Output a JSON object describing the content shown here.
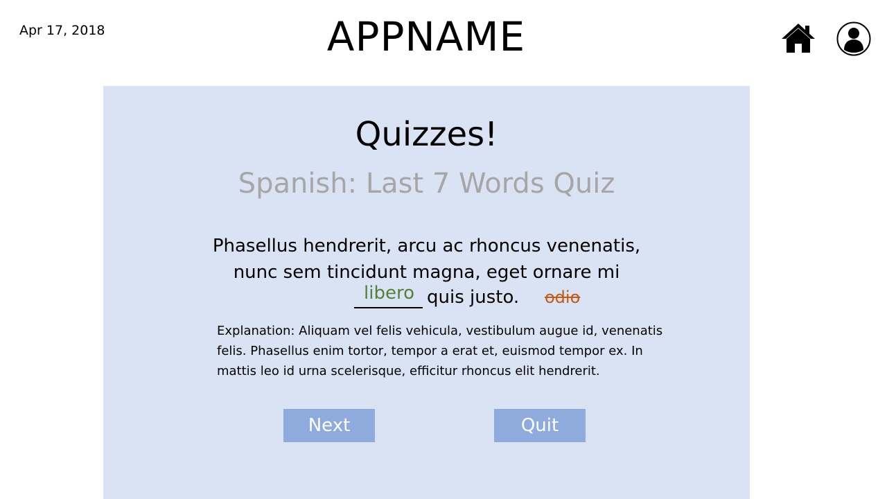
{
  "header": {
    "date": "Apr 17, 2018",
    "app_name": "APPNAME"
  },
  "icons": {
    "home": "home-icon",
    "profile": "user-profile-icon"
  },
  "quiz": {
    "title": "Quizzes!",
    "name": "Spanish: Last 7 Words Quiz",
    "question_line1": "Phasellus hendrerit, arcu ac rhoncus venenatis,",
    "question_line2": "nunc sem tincidunt magna, eget ornare mi",
    "after_blank": "quis justo.",
    "correct_answer": "libero",
    "wrong_answer": "odio",
    "explanation": "Explanation: Aliquam vel felis vehicula, vestibulum augue id, venenatis felis. Phasellus enim tortor, tempor a erat et, euismod tempor ex. In mattis leo id urna scelerisque, efficitur rhoncus elit hendrerit."
  },
  "buttons": {
    "next": "Next",
    "quit": "Quit"
  },
  "colors": {
    "panel_bg": "#dae3f3",
    "button_bg": "#8faadc",
    "correct": "#548235",
    "wrong": "#c55a11",
    "subtitle": "#a6a6a6"
  }
}
